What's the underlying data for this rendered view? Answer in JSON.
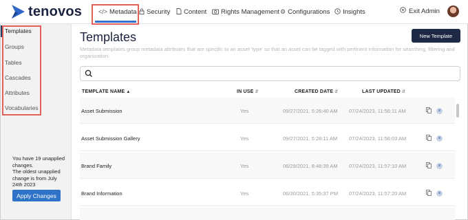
{
  "brand": {
    "name": "tenovos",
    "color": "#2f66c8"
  },
  "nav": {
    "items": [
      {
        "label": "Metadata",
        "icon": "code-icon",
        "active": true
      },
      {
        "label": "Security",
        "icon": "lock-icon"
      },
      {
        "label": "Content",
        "icon": "file-icon"
      },
      {
        "label": "Rights Management",
        "icon": "camera-icon"
      },
      {
        "label": "Configurations",
        "icon": "gear-icon"
      },
      {
        "label": "Insights",
        "icon": "clock-icon"
      }
    ],
    "exit_admin": "Exit Admin"
  },
  "sidebar": {
    "items": [
      {
        "label": "Templates",
        "active": true
      },
      {
        "label": "Groups"
      },
      {
        "label": "Tables"
      },
      {
        "label": "Cascades"
      },
      {
        "label": "Attributes"
      },
      {
        "label": "Vocabularies"
      }
    ],
    "unapplied_text": "You have 19 unapplied changes.\nThe oldest unapplied change is from July 24th 2023",
    "apply_label": "Apply Changes"
  },
  "main": {
    "title": "Templates",
    "new_button": "New Template",
    "description": "Metadata templates group metadata attributes that are specific to an asset 'type' so that an asset can be tagged with pertinent information for searching, filtering and organization.",
    "search_placeholder": ""
  },
  "table": {
    "columns": [
      "TEMPLATE NAME",
      "IN USE",
      "CREATED DATE",
      "LAST UPDATED"
    ],
    "rows": [
      {
        "name": "Asset Submission",
        "in_use": "Yes",
        "created": "09/27/2021, 5:26:40 AM",
        "updated": "07/24/2023, 11:56:11 AM"
      },
      {
        "name": "Asset Submission Gallery",
        "in_use": "Yes",
        "created": "09/27/2021, 5:28:11 AM",
        "updated": "07/24/2023, 11:56:03 AM"
      },
      {
        "name": "Brand Family",
        "in_use": "Yes",
        "created": "06/29/2021, 8:48:39 AM",
        "updated": "07/24/2023, 11:57:10 AM"
      },
      {
        "name": "Brand Information",
        "in_use": "Yes",
        "created": "06/30/2021, 5:35:37 PM",
        "updated": "07/24/2023, 11:57:20 AM"
      }
    ]
  },
  "colors": {
    "accent": "#2e73c8",
    "highlight": "#e0605a",
    "dark": "#1e2a45"
  }
}
